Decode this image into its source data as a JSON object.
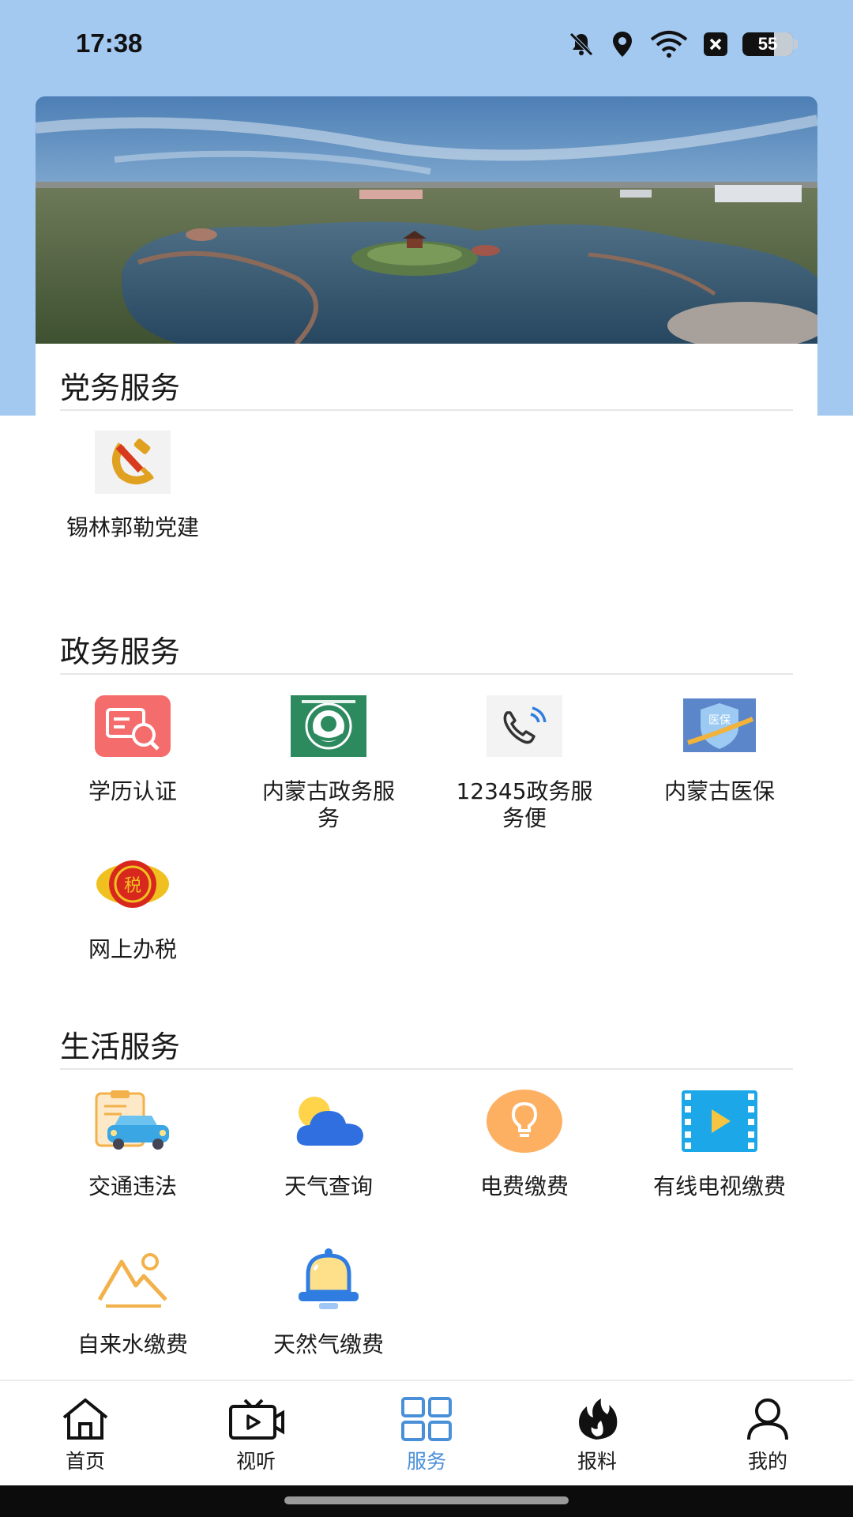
{
  "status_bar": {
    "time": "17:38",
    "battery": "55",
    "icons": [
      "bell-off-icon",
      "location-icon",
      "wifi-icon",
      "x-box-icon",
      "battery-icon"
    ]
  },
  "banner": {
    "icon": "banner-image"
  },
  "sections": {
    "party": {
      "title": "党务服务",
      "items": [
        {
          "label": "锡林郭勒党建",
          "icon": "party-emblem-icon"
        }
      ]
    },
    "gov": {
      "title": "政务服务",
      "items": [
        {
          "label": "学历认证",
          "icon": "certificate-search-icon"
        },
        {
          "label": "内蒙古政务服务",
          "icon": "gov-service-emblem-icon"
        },
        {
          "label": "12345政务服务便",
          "icon": "phone-call-icon"
        },
        {
          "label": "内蒙古医保",
          "icon": "medical-insurance-icon"
        },
        {
          "label": "网上办税",
          "icon": "tax-emblem-icon"
        }
      ]
    },
    "life": {
      "title": "生活服务",
      "items": [
        {
          "label": "交通违法",
          "icon": "car-ticket-icon"
        },
        {
          "label": "天气查询",
          "icon": "weather-cloud-icon"
        },
        {
          "label": "电费缴费",
          "icon": "lightbulb-icon"
        },
        {
          "label": "有线电视缴费",
          "icon": "video-film-icon"
        },
        {
          "label": "自来水缴费",
          "icon": "mountain-water-icon"
        },
        {
          "label": "天然气缴费",
          "icon": "gas-bell-icon"
        }
      ]
    }
  },
  "bottom_nav": {
    "active": "服务",
    "items": [
      {
        "label": "首页",
        "icon": "home-icon"
      },
      {
        "label": "视听",
        "icon": "tv-play-icon"
      },
      {
        "label": "服务",
        "icon": "grid-icon"
      },
      {
        "label": "报料",
        "icon": "flame-icon"
      },
      {
        "label": "我的",
        "icon": "user-icon"
      }
    ]
  },
  "colors": {
    "top_background": "#a3c9f1",
    "accent": "#4a90d9"
  }
}
